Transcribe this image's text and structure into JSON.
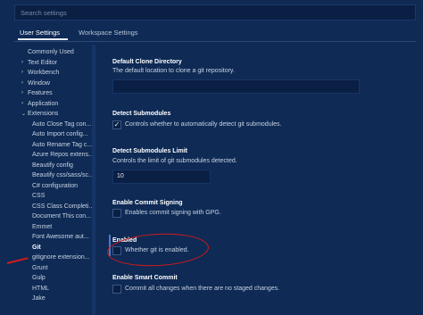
{
  "search": {
    "placeholder": "Search settings"
  },
  "tabs": [
    {
      "label": "User Settings",
      "active": true
    },
    {
      "label": "Workspace Settings",
      "active": false
    }
  ],
  "tree": [
    {
      "label": "Commonly Used",
      "arrow": "",
      "level": 1
    },
    {
      "label": "Text Editor",
      "arrow": "›",
      "level": 1
    },
    {
      "label": "Workbench",
      "arrow": "›",
      "level": 1
    },
    {
      "label": "Window",
      "arrow": "›",
      "level": 1
    },
    {
      "label": "Features",
      "arrow": "›",
      "level": 1
    },
    {
      "label": "Application",
      "arrow": "›",
      "level": 1
    },
    {
      "label": "Extensions",
      "arrow": "⌄",
      "level": 1
    },
    {
      "label": "Auto Close Tag con...",
      "arrow": "",
      "level": 2
    },
    {
      "label": "Auto Import config...",
      "arrow": "",
      "level": 2
    },
    {
      "label": "Auto Rename Tag c...",
      "arrow": "",
      "level": 2
    },
    {
      "label": "Azure Repos extens...",
      "arrow": "",
      "level": 2
    },
    {
      "label": "Beautify config",
      "arrow": "",
      "level": 2
    },
    {
      "label": "Beautify css/sass/sc...",
      "arrow": "",
      "level": 2
    },
    {
      "label": "C# configuration",
      "arrow": "",
      "level": 2
    },
    {
      "label": "CSS",
      "arrow": "",
      "level": 2
    },
    {
      "label": "CSS Class Completi...",
      "arrow": "",
      "level": 2
    },
    {
      "label": "Document This con...",
      "arrow": "",
      "level": 2
    },
    {
      "label": "Emmet",
      "arrow": "",
      "level": 2
    },
    {
      "label": "Font Awesome aut...",
      "arrow": "",
      "level": 2
    },
    {
      "label": "Git",
      "arrow": "",
      "level": 2,
      "selected": true
    },
    {
      "label": "gitignore extension...",
      "arrow": "",
      "level": 2
    },
    {
      "label": "Grunt",
      "arrow": "",
      "level": 2
    },
    {
      "label": "Gulp",
      "arrow": "",
      "level": 2
    },
    {
      "label": "HTML",
      "arrow": "",
      "level": 2
    },
    {
      "label": "Jake",
      "arrow": "",
      "level": 2
    }
  ],
  "settings": {
    "clone_dir": {
      "title": "Default Clone Directory",
      "desc": "The default location to clone a git repository.",
      "value": ""
    },
    "submodules": {
      "title": "Detect Submodules",
      "label": "Controls whether to automatically detect git submodules.",
      "checked": true,
      "mark": "✓"
    },
    "submodules_limit": {
      "title": "Detect Submodules Limit",
      "desc": "Controls the limit of git submodules detected.",
      "value": "10"
    },
    "commit_signing": {
      "title": "Enable Commit Signing",
      "label": "Enables commit signing with GPG.",
      "checked": false
    },
    "enabled": {
      "title": "Enabled",
      "label": "Whether git is enabled.",
      "checked": false
    },
    "smart_commit": {
      "title": "Enable Smart Commit",
      "label": "Commit all changes when there are no staged changes.",
      "checked": false
    }
  },
  "colors": {
    "background": "#0e2a55",
    "annotation": "#d41a1a"
  }
}
